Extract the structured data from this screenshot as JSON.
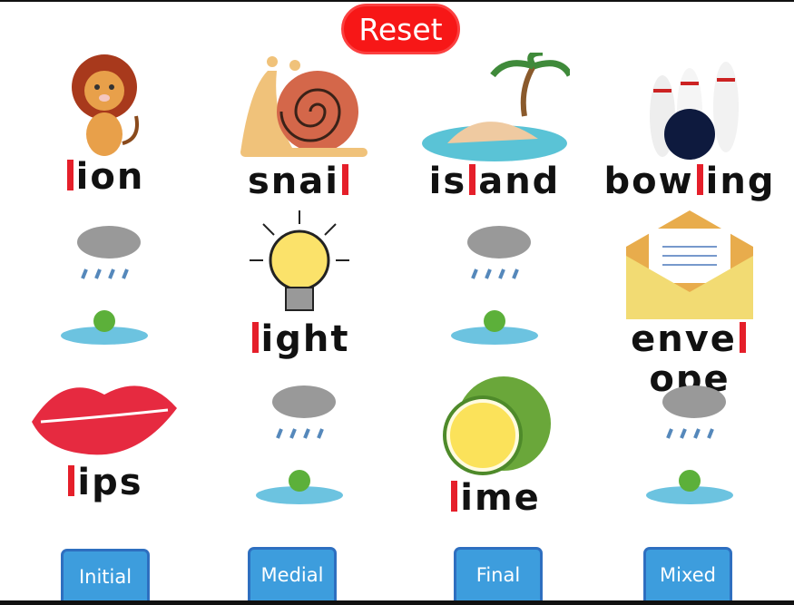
{
  "reset_label": "Reset",
  "accent_color": "#e51f2a",
  "button_color": "#3d9ddd",
  "cells": [
    {
      "icon": "lion-icon",
      "pre": "",
      "hl": "l",
      "post": "ion"
    },
    {
      "icon": "snail-icon",
      "pre": "snai",
      "hl": "l",
      "post": ""
    },
    {
      "icon": "island-icon",
      "pre": "is",
      "hl": "l",
      "post": "and"
    },
    {
      "icon": "bowling-icon",
      "pre": "bow",
      "hl": "l",
      "post": "ing"
    },
    {
      "icon": "rain-frog-icon"
    },
    {
      "icon": "lightbulb-icon",
      "pre": "",
      "hl": "l",
      "post": "ight"
    },
    {
      "icon": "rain-frog-icon"
    },
    {
      "icon": "envelope-icon",
      "pre": "enve",
      "hl": "l",
      "post": "ope"
    },
    {
      "icon": "lips-icon",
      "pre": "",
      "hl": "l",
      "post": "ips"
    },
    {
      "icon": "rain-frog-icon"
    },
    {
      "icon": "lime-icon",
      "pre": "",
      "hl": "l",
      "post": "ime"
    },
    {
      "icon": "rain-frog-icon"
    }
  ],
  "buttons": [
    "Initial",
    "Medial",
    "Final",
    "Mixed"
  ]
}
